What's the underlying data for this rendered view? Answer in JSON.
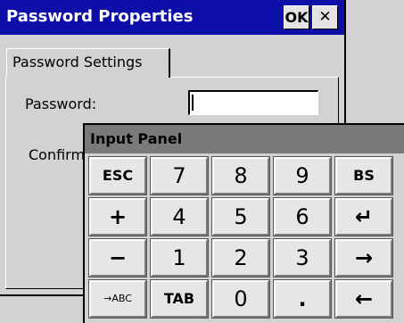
{
  "dialog": {
    "title": "Password Properties",
    "ok_label": "OK",
    "close_label": "✕",
    "tab_label": "Password Settings",
    "password_label": "Password:",
    "confirm_label": "Confirm",
    "password_value": ""
  },
  "input_panel": {
    "title": "Input Panel",
    "keys": [
      "ESC",
      "7",
      "8",
      "9",
      "BS",
      "+",
      "4",
      "5",
      "6",
      "↵",
      "−",
      "1",
      "2",
      "3",
      "→",
      "→ABC",
      "TAB",
      "0",
      ".",
      "←"
    ]
  }
}
